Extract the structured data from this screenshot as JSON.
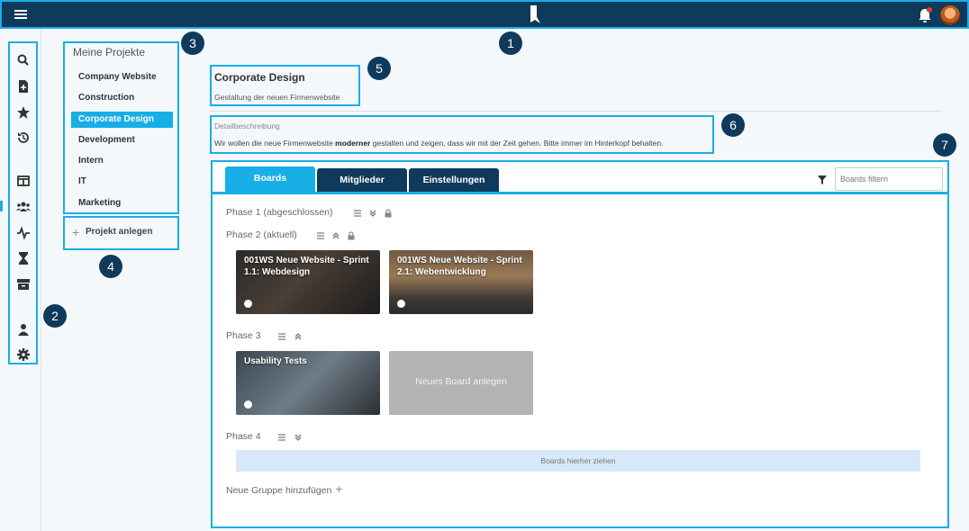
{
  "topbar": {
    "logo": "app-logo",
    "notification_icon": "bell-icon",
    "avatar": "user-avatar"
  },
  "rail": {
    "icons": [
      "search-icon",
      "add-file-icon",
      "star-icon",
      "history-icon",
      "boards-icon",
      "team-icon",
      "activity-icon",
      "hourglass-icon",
      "archive-icon",
      "user-icon",
      "gear-icon"
    ]
  },
  "projects": {
    "title": "Meine Projekte",
    "items": [
      "Company Website",
      "Construction",
      "Corporate Design",
      "Development",
      "Intern",
      "IT",
      "Marketing"
    ],
    "active": "Corporate Design",
    "new_project": "Projekt anlegen"
  },
  "header": {
    "title": "Corporate Design",
    "subtitle": "Gestaltung der neuen Firmenwebsite",
    "desc_label": "Detailbeschreibung",
    "desc_pre": "Wir wollen die neue Firmenwebsite ",
    "desc_bold": "moderner",
    "desc_post": " gestalten und zeigen, dass wir mit der Zeit gehen. Bitte immer im Hinterkopf behalten."
  },
  "tabs": [
    "Boards",
    "Mitglieder",
    "Einstellungen"
  ],
  "filter": {
    "placeholder": "Boards filtern"
  },
  "phases": [
    {
      "label": "Phase 1 (abgeschlossen)"
    },
    {
      "label": "Phase 2 (aktuell)"
    },
    {
      "label": "Phase 3"
    },
    {
      "label": "Phase 4"
    }
  ],
  "cards": {
    "c1": "001WS Neue Website - Sprint 1.1: Webdesign",
    "c2": "001WS Neue Website - Sprint 2.1: Webentwicklung",
    "c3": "Usability Tests",
    "new_board": "Neues Board anlegen"
  },
  "dropzone": "Boards hierher ziehen",
  "add_group": "Neue Gruppe hinzufügen",
  "callouts": [
    "1",
    "2",
    "3",
    "4",
    "5",
    "6",
    "7"
  ],
  "colors": {
    "accent": "#18aee6",
    "navy": "#0f3a5c"
  }
}
